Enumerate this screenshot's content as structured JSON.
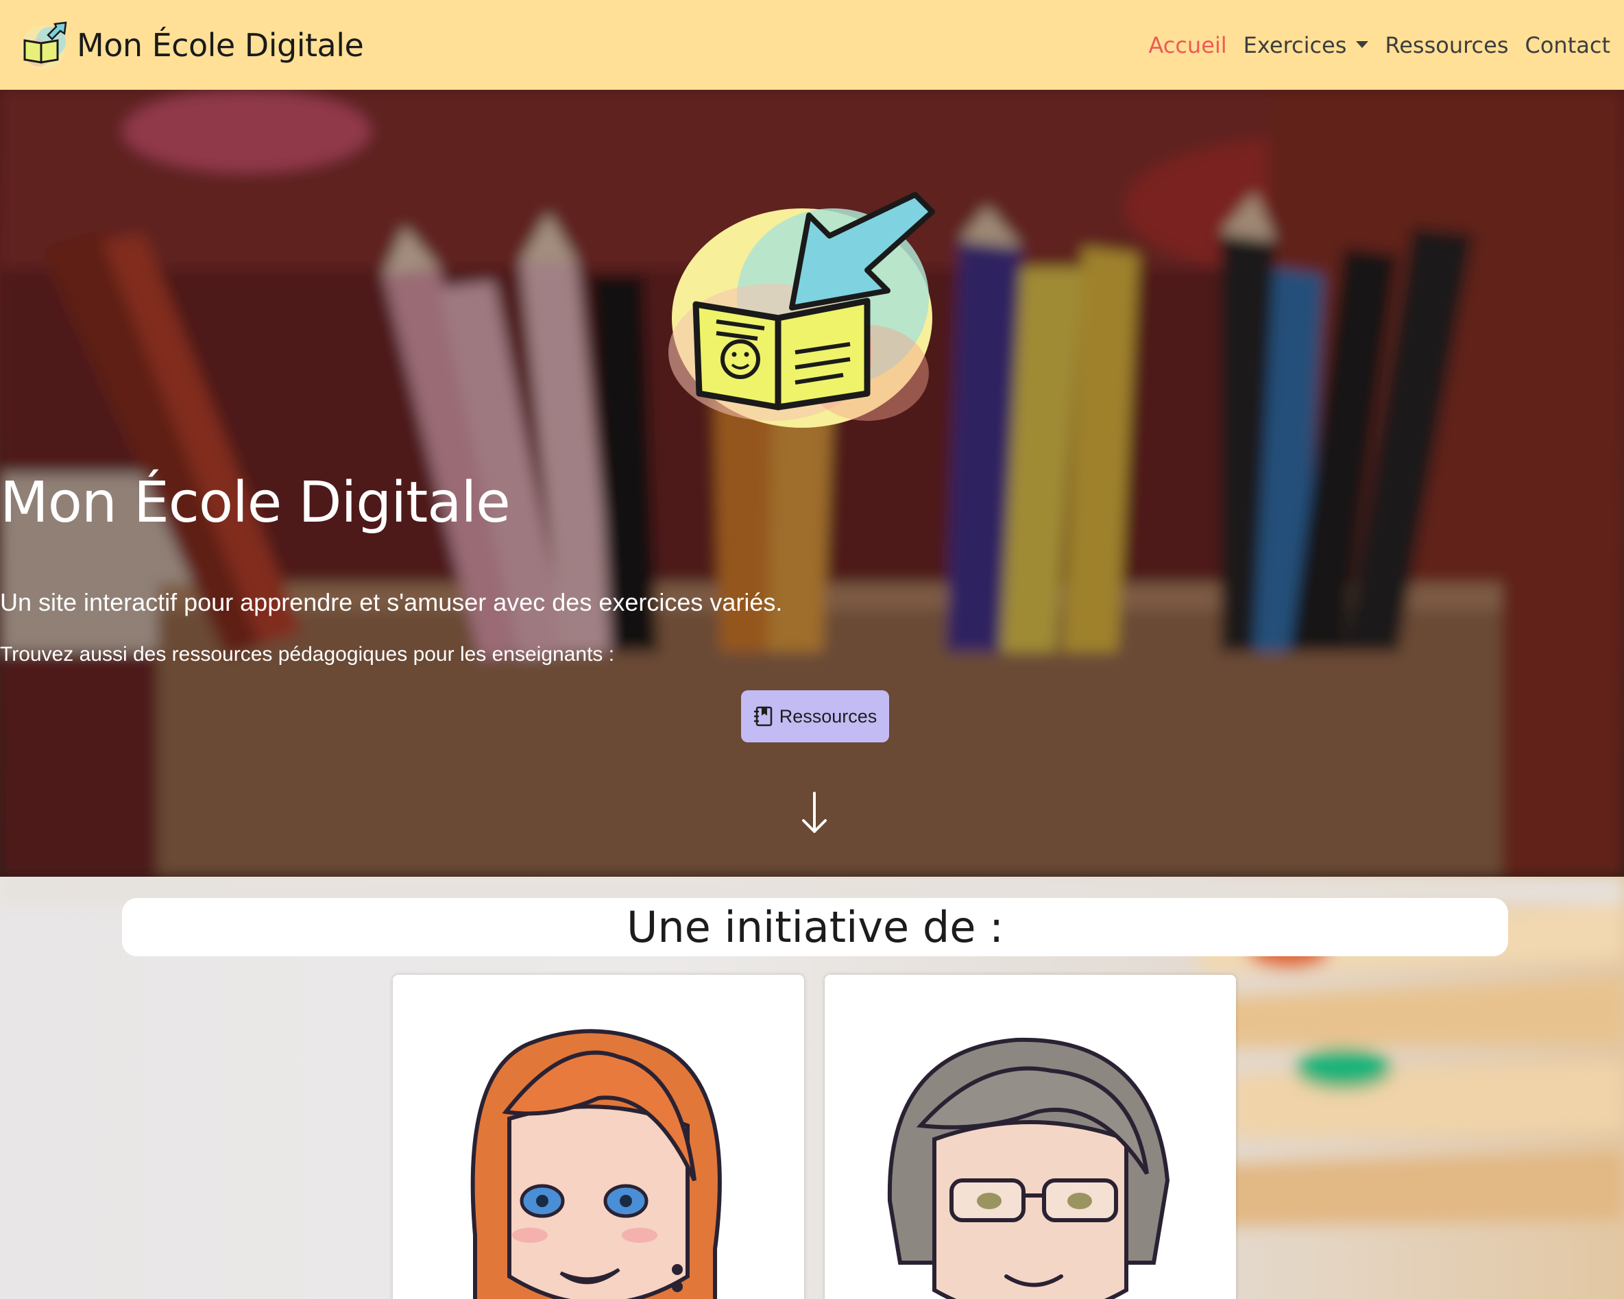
{
  "navbar": {
    "brand": "Mon École Digitale",
    "links": [
      {
        "label": "Accueil",
        "active": true
      },
      {
        "label": "Exercices",
        "dropdown": true
      },
      {
        "label": "Ressources"
      },
      {
        "label": "Contact"
      }
    ]
  },
  "hero": {
    "title": "Mon École Digitale",
    "subtitle": "Un site interactif pour apprendre et s'amuser avec des exercices variés.",
    "subtitle2": "Trouvez aussi des ressources pédagogiques pour les enseignants :",
    "button_label": "Ressources",
    "button_icon": "journal-bookmark-icon",
    "scroll_icon": "arrow-down-icon"
  },
  "section": {
    "heading": "Une initiative de :"
  },
  "colors": {
    "navbar_bg": "#ffe096",
    "active_link": "#ee5a55",
    "button_bg": "#c3bbf3"
  }
}
